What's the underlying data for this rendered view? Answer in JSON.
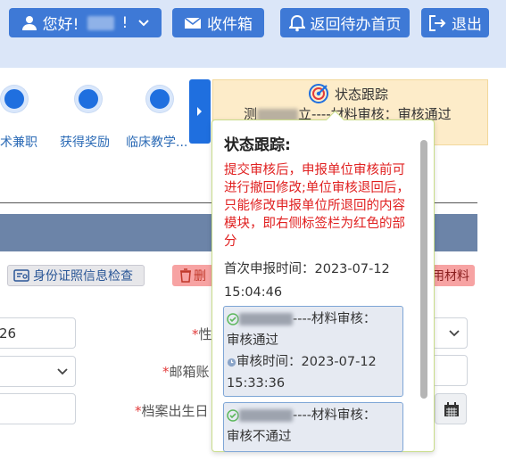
{
  "header": {
    "greeting": "您好!",
    "greeting_suffix": "!",
    "inbox": "收件箱",
    "back_home": "返回待办首页",
    "logout": "退出"
  },
  "steps": [
    {
      "label": "术兼职"
    },
    {
      "label": "获得奖励"
    },
    {
      "label": "临床教学..."
    }
  ],
  "status_box": {
    "title": "状态跟踪",
    "line_prefix": "测",
    "line_mid": "立",
    "line_text": "----材料审核：审核通过"
  },
  "toolbar": {
    "id_check": "身份证照信息检查",
    "delete": "删",
    "materials": "用材料"
  },
  "form": {
    "field1_value": "26",
    "gender_label": "性",
    "email_label": "邮箱账",
    "birth_label": "档案出生日"
  },
  "popover": {
    "title": "状态跟踪:",
    "note": "提交审核后，申报单位审核前可进行撤回修改;单位审核退回后，只能修改申报单位所退回的内容模块，即右侧标签栏为红色的部分",
    "first_time_label": "首次申报时间：2023-07-12",
    "first_time_clock": "15:04:46",
    "records": [
      {
        "text": "----材料审核：",
        "result": "审核通过",
        "time_label": "审核时间：2023-07-12",
        "time_clock": "15:33:36"
      },
      {
        "text": "----材料审核：",
        "result": "审核不通过"
      }
    ]
  },
  "colors": {
    "header_bg": "#dbe6f8",
    "header_button": "#3e79d6",
    "status_box_bg": "#fdecc9",
    "note_red": "#e02020"
  }
}
